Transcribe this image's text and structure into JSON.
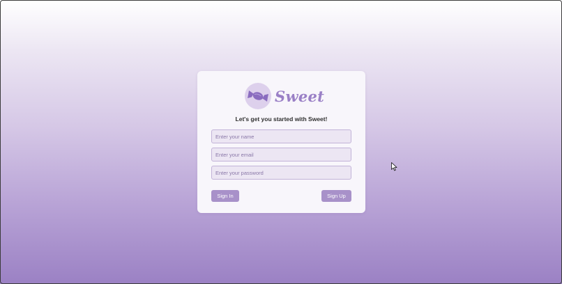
{
  "brand": {
    "name": "Sweet",
    "logo_icon": "candy-icon",
    "accent_color": "#9a80c6"
  },
  "signup_form": {
    "tagline": "Let's get you started with Sweet!",
    "name_placeholder": "Enter your name",
    "email_placeholder": "Enter your email",
    "password_placeholder": "Enter your password",
    "sign_in_label": "Sign In",
    "sign_up_label": "Sign Up",
    "button_color": "#a891c9"
  },
  "pointer": {
    "icon": "mouse-pointer-icon"
  }
}
